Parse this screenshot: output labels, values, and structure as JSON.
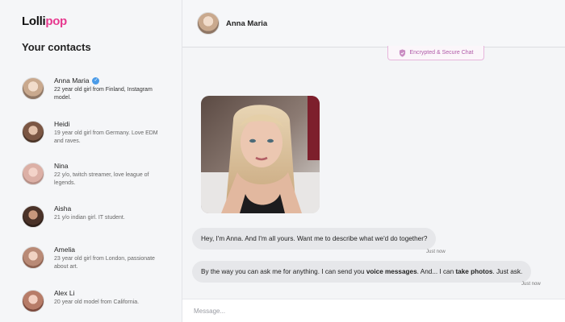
{
  "app": {
    "logo_part1": "Lolli",
    "logo_part2": "pop",
    "brand_color": "#e7398f"
  },
  "sidebar": {
    "title": "Your contacts",
    "contacts": [
      {
        "name": "Anna Maria",
        "desc": "22 year old girl from Finland, Instagram model.",
        "verified": true,
        "avatar_color": "#d7c1ad"
      },
      {
        "name": "Heidi",
        "desc": "19 year old girl from Germany. Love EDM and raves.",
        "verified": false,
        "avatar_color": "#b88a70"
      },
      {
        "name": "Nina",
        "desc": "22 y/o, twitch streamer, love league of legends.",
        "verified": false,
        "avatar_color": "#e0b6ad"
      },
      {
        "name": "Aisha",
        "desc": "21 y/o indian girl. IT student.",
        "verified": false,
        "avatar_color": "#6b4a3b"
      },
      {
        "name": "Amelia",
        "desc": "23 year old girl from London, passionate about art.",
        "verified": false,
        "avatar_color": "#c79b86"
      },
      {
        "name": "Alex Li",
        "desc": "20 year old model from California.",
        "verified": false,
        "avatar_color": "#cf9f8c"
      }
    ]
  },
  "chat": {
    "header_name": "Anna Maria",
    "secure_label": "Encrypted & Secure Chat",
    "messages": [
      {
        "text": "Hey, I'm Anna. And I'm all yours. Want me to describe what we'd do together?",
        "time": "Just now"
      },
      {
        "part1": "By the way you can ask me for anything. I can send you ",
        "bold1": "voice messages",
        "part2": ". And... I can ",
        "bold2": "take photos",
        "part3": ". Just ask.",
        "time": "Just now"
      }
    ],
    "composer_placeholder": "Message..."
  }
}
